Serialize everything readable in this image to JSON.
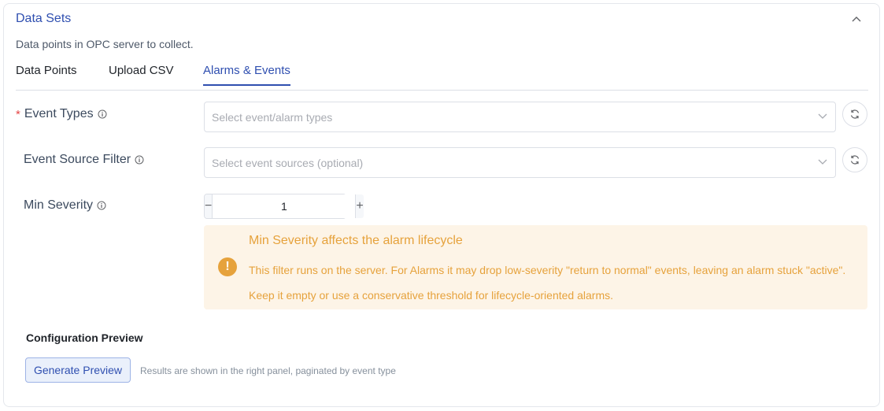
{
  "section": {
    "title": "Data Sets",
    "description": "Data points in OPC server to collect."
  },
  "tabs": [
    {
      "label": "Data Points"
    },
    {
      "label": "Upload CSV"
    },
    {
      "label": "Alarms & Events",
      "active": true
    }
  ],
  "form": {
    "event_types": {
      "required_mark": "*",
      "label": "Event Types",
      "placeholder": "Select event/alarm types"
    },
    "event_source_filter": {
      "label": "Event Source Filter",
      "placeholder": "Select event sources (optional)"
    },
    "min_severity": {
      "label": "Min Severity",
      "value": "1",
      "minus": "−",
      "plus": "+"
    }
  },
  "alert": {
    "icon_text": "!",
    "title": "Min Severity affects the alarm lifecycle",
    "body": "This filter runs on the server. For Alarms it may drop low-severity \"return to normal\" events, leaving an alarm stuck \"active\". Keep it empty or use a conservative threshold for lifecycle-oriented alarms."
  },
  "preview": {
    "title": "Configuration Preview",
    "button_label": "Generate Preview",
    "hint": "Results are shown in the right panel, paginated by event type"
  },
  "colors": {
    "accent": "#2f4fb0",
    "warning": "#e6a23c",
    "warning_bg": "#fdf4e7",
    "required": "#e54545"
  },
  "icons": [
    "chevron-up-icon",
    "info-icon",
    "chevron-down-icon",
    "refresh-icon",
    "warning-icon"
  ]
}
